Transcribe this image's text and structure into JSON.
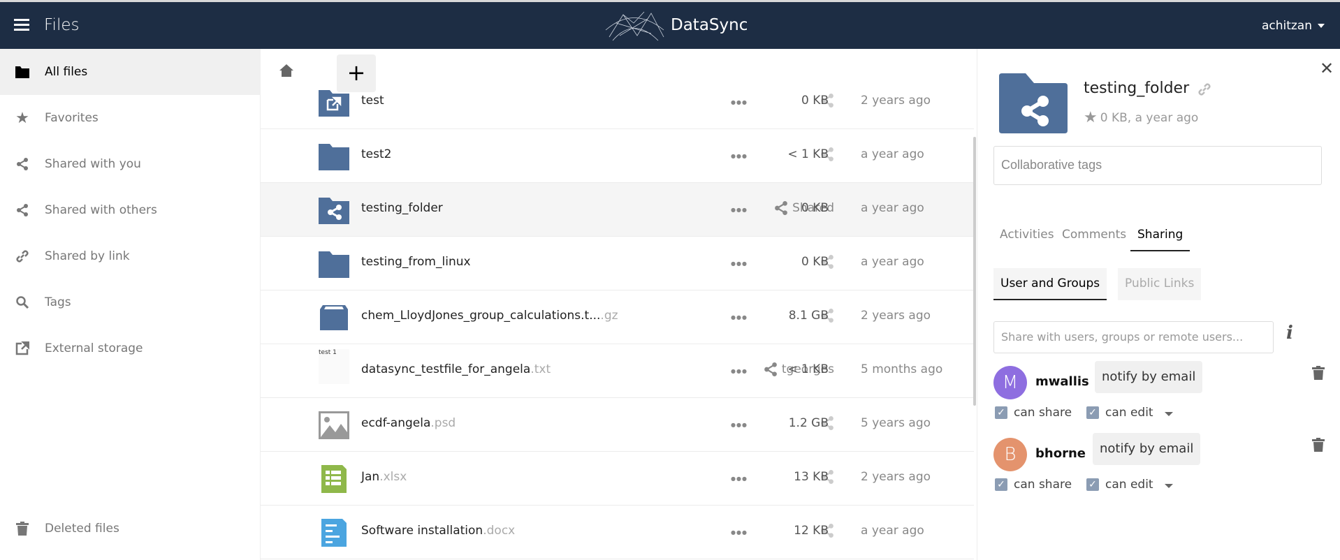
{
  "header": {
    "app_title": "Files",
    "brand": "DataSync",
    "user": "achitzan"
  },
  "sidebar": {
    "items": [
      {
        "label": "All files",
        "icon": "folder-icon",
        "active": true
      },
      {
        "label": "Favorites",
        "icon": "star-icon"
      },
      {
        "label": "Shared with you",
        "icon": "share-icon"
      },
      {
        "label": "Shared with others",
        "icon": "share-icon"
      },
      {
        "label": "Shared by link",
        "icon": "link-icon"
      },
      {
        "label": "Tags",
        "icon": "search-icon"
      },
      {
        "label": "External storage",
        "icon": "external-icon"
      }
    ],
    "deleted": "Deleted files"
  },
  "toolbar": {
    "add_label": "+"
  },
  "files": [
    {
      "name": "test",
      "ext": "",
      "share": "",
      "size": "0 KB",
      "date": "2 years ago",
      "icon": "external-folder"
    },
    {
      "name": "test2",
      "ext": "",
      "share": "",
      "size": "< 1 KB",
      "date": "a year ago",
      "icon": "folder"
    },
    {
      "name": "testing_folder",
      "ext": "",
      "share": "Shared",
      "size": "0 KB",
      "date": "a year ago",
      "icon": "shared-folder",
      "highlighted": true
    },
    {
      "name": "testing_from_linux",
      "ext": "",
      "share": "",
      "size": "0 KB",
      "date": "a year ago",
      "icon": "folder"
    },
    {
      "name": "chem_LloydJones_group_calculations.t...",
      "ext": ".gz",
      "share": "",
      "size": "8.1 GB",
      "date": "2 years ago",
      "icon": "archive"
    },
    {
      "name": "datasync_testfile_for_angela",
      "ext": ".txt",
      "share": "tgeorges",
      "size": "< 1 KB",
      "date": "5 months ago",
      "icon": "text-preview",
      "preview": "test 1"
    },
    {
      "name": "ecdf-angela",
      "ext": ".psd",
      "share": "",
      "size": "1.2 GB",
      "date": "5 years ago",
      "icon": "image"
    },
    {
      "name": "Jan",
      "ext": ".xlsx",
      "share": "",
      "size": "13 KB",
      "date": "2 years ago",
      "icon": "spreadsheet"
    },
    {
      "name": "Software installation",
      "ext": ".docx",
      "share": "",
      "size": "12 KB",
      "date": "a year ago",
      "icon": "document"
    }
  ],
  "details": {
    "title": "testing_folder",
    "meta": "0 KB, a year ago",
    "tags_placeholder": "Collaborative tags",
    "tabs": [
      "Activities",
      "Comments",
      "Sharing"
    ],
    "subtabs": [
      "User and Groups",
      "Public Links"
    ],
    "share_placeholder": "Share with users, groups or remote users...",
    "info": "i",
    "shares": [
      {
        "initial": "M",
        "user": "mwallis",
        "notify": "notify by email",
        "can_share": "can share",
        "can_edit": "can edit",
        "color": "#8e6ee0"
      },
      {
        "initial": "B",
        "user": "bhorne",
        "notify": "notify by email",
        "can_share": "can share",
        "can_edit": "can edit",
        "color": "#e4936d"
      }
    ]
  },
  "colors": {
    "header": "#1d2d44",
    "folder": "#4f6f9a"
  }
}
